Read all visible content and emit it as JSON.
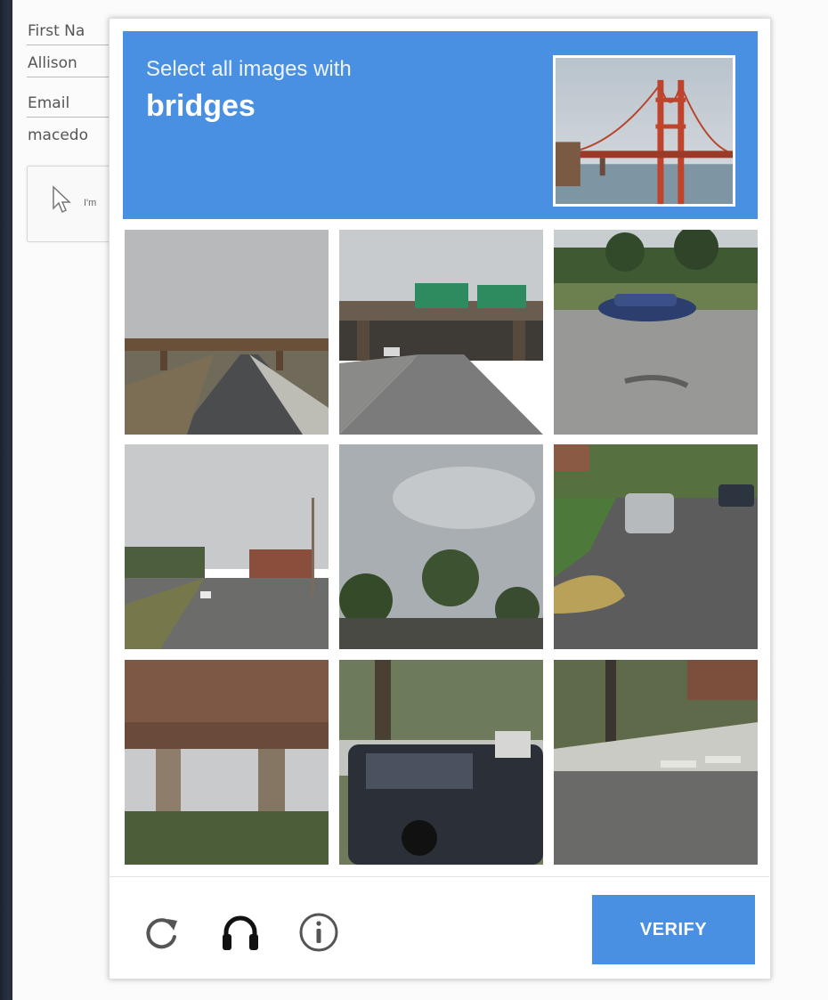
{
  "form": {
    "first_name_label": "First Na",
    "first_name_value": "Allison",
    "email_label": "Email",
    "email_value": "macedo",
    "checkbox_snippet": "I'm"
  },
  "captcha": {
    "instruction": "Select all images with",
    "target": "bridges",
    "accent_color": "#4a90e2",
    "verify_label": "VERIFY",
    "icons": [
      "reload-icon",
      "headphones-icon",
      "info-icon"
    ],
    "tiles": [
      {
        "scene": "highway-overpass"
      },
      {
        "scene": "overpass-with-green-signs"
      },
      {
        "scene": "street-with-parked-car"
      },
      {
        "scene": "city-street"
      },
      {
        "scene": "cloudy-sky-trees"
      },
      {
        "scene": "residential-street-with-car"
      },
      {
        "scene": "underside-of-bridge"
      },
      {
        "scene": "parked-car-under-tree"
      },
      {
        "scene": "sidewalk-crosswalk"
      }
    ]
  }
}
